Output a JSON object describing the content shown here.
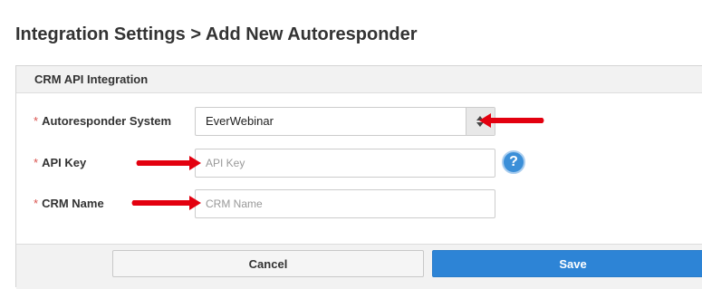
{
  "header": {
    "title": "Integration Settings > Add New Autoresponder"
  },
  "panel": {
    "title": "CRM API Integration"
  },
  "form": {
    "required_marker": "*",
    "autoresponder": {
      "label": "Autoresponder System",
      "value": "EverWebinar"
    },
    "api_key": {
      "label": "API Key",
      "placeholder": "API Key",
      "value": ""
    },
    "crm_name": {
      "label": "CRM Name",
      "placeholder": "CRM Name",
      "value": ""
    },
    "help_icon_glyph": "?"
  },
  "buttons": {
    "cancel_label": "Cancel",
    "save_label": "Save"
  },
  "colors": {
    "required": "#d9534f",
    "save_button": "#2d84d6",
    "help_icon": "#3b8fd8",
    "annotation_arrow": "#e3000f"
  },
  "icons": {
    "select_arrows": "updown-arrows-icon",
    "help": "question-circle-icon",
    "annotation": "red-arrow-icon"
  }
}
